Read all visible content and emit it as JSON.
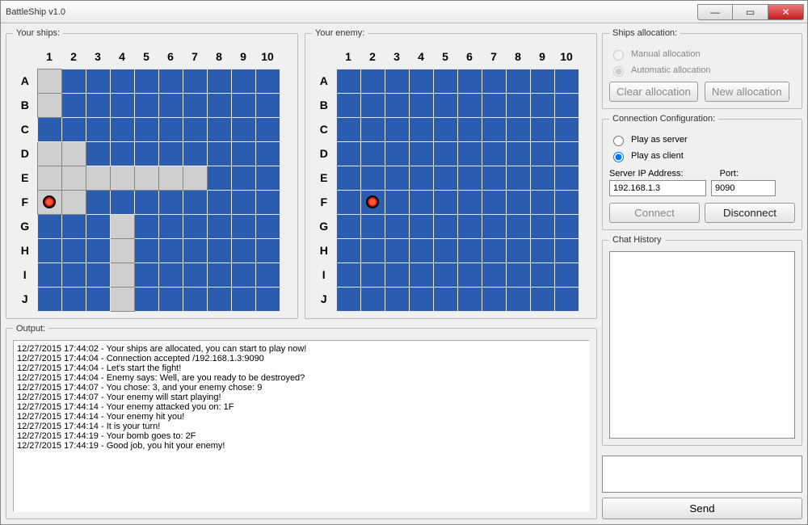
{
  "window": {
    "title": "BattleShip v1.0"
  },
  "winbtns": {
    "min": "—",
    "max": "▭",
    "close": "✕"
  },
  "groups": {
    "your_ships": "Your ships:",
    "your_enemy": "Your enemy:",
    "ships_alloc": "Ships allocation:",
    "conn_conf": "Connection Configuration:",
    "output": "Output:",
    "chat_history": "Chat History"
  },
  "grid": {
    "cols": [
      "1",
      "2",
      "3",
      "4",
      "5",
      "6",
      "7",
      "8",
      "9",
      "10"
    ],
    "rows": [
      "A",
      "B",
      "C",
      "D",
      "E",
      "F",
      "G",
      "H",
      "I",
      "J"
    ]
  },
  "your_ships": {
    "ship_cells": [
      "A1",
      "B1",
      "D1",
      "E1",
      "F1",
      "D2",
      "E2",
      "F2",
      "E3",
      "E4",
      "E5",
      "E6",
      "E7",
      "G4",
      "H4",
      "I4",
      "J4"
    ],
    "hit_cells": [
      "F1"
    ]
  },
  "enemy": {
    "hit_cells": [
      "F2"
    ]
  },
  "alloc": {
    "manual": "Manual allocation",
    "auto": "Automatic allocation",
    "selected": "auto",
    "enabled": false,
    "clear": "Clear allocation",
    "new": "New allocation"
  },
  "conn": {
    "server": "Play as server",
    "client": "Play as client",
    "selected": "client",
    "ip_label": "Server IP Address:",
    "port_label": "Port:",
    "ip": "192.168.1.3",
    "port": "9090",
    "connect": "Connect",
    "disconnect": "Disconnect",
    "connect_enabled": false
  },
  "output_lines": [
    "12/27/2015 17:44:02 - Your ships are allocated, you can start to play now!",
    "12/27/2015 17:44:04 - Connection accepted /192.168.1.3:9090",
    "12/27/2015 17:44:04 - Let's start the fight!",
    "12/27/2015 17:44:04 - Enemy says: Well, are you ready to be destroyed?",
    "12/27/2015 17:44:07 - You chose: 3, and your enemy chose: 9",
    "12/27/2015 17:44:07 - Your enemy will start playing!",
    "12/27/2015 17:44:14 - Your enemy attacked you on: 1F",
    "12/27/2015 17:44:14 - Your enemy hit you!",
    "12/27/2015 17:44:14 - It is your turn!",
    "12/27/2015 17:44:19 - Your bomb goes to: 2F",
    "12/27/2015 17:44:19 - Good job, you hit your enemy!"
  ],
  "chat": {
    "send": "Send"
  }
}
